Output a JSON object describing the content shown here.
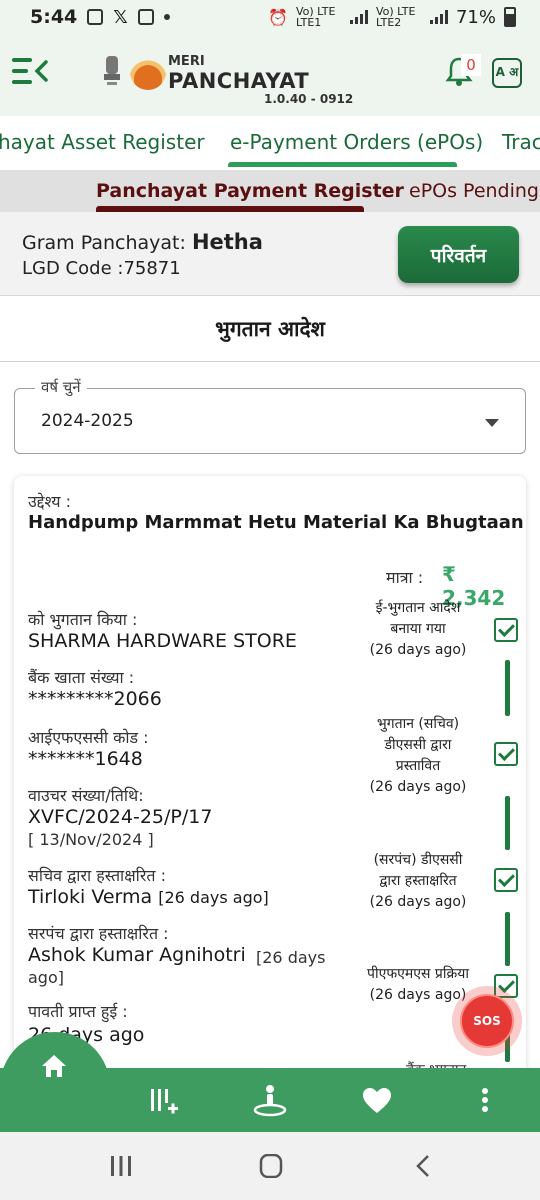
{
  "status_bar": {
    "time": "5:44",
    "network1": "Vo) LTE LTE1",
    "network2": "Vo) LTE LTE2",
    "battery": "71%"
  },
  "header": {
    "logo_small": "MERI",
    "logo_text": "PANCHAYAT",
    "version": "1.0.40 - 0912",
    "notification_count": "0",
    "lang_icon_text": "A अ"
  },
  "tabs": [
    {
      "label": "hayat Asset Register"
    },
    {
      "label": "e-Payment Orders (ePOs)"
    },
    {
      "label": "Trac"
    }
  ],
  "subtabs": [
    {
      "label": "Panchayat Payment Register"
    },
    {
      "label": "ePOs Pending"
    }
  ],
  "panchayat": {
    "gp_label": "Gram Panchayat: ",
    "gp_name": "Hetha",
    "lgd_label": "LGD Code :",
    "lgd_code": "75871",
    "change_button": "परिवर्तन"
  },
  "section_title": "भुगतान आदेश",
  "year_select": {
    "label": "वर्ष चुनें",
    "value": "2024-2025"
  },
  "order": {
    "purpose_label": "उद्देश्य :",
    "purpose": "Handpump Marmmat Hetu Material Ka Bhugtaan",
    "amount_label": "मात्रा :",
    "amount": "₹ 2,342",
    "paid_to_label": "को भुगतान किया :",
    "paid_to": "SHARMA HARDWARE STORE",
    "account_label": "बैंक खाता संख्या :",
    "account": "*********2066",
    "ifsc_label": "आईएफएससी कोड :",
    "ifsc": "*******1648",
    "voucher_label": "वाउचर संख्या/तिथि:",
    "voucher": "XVFC/2024-25/P/17",
    "voucher_date": "[ 13/Nov/2024 ]",
    "secretary_label": "सचिव द्वारा हस्ताक्षरित :",
    "secretary": "Tirloki Verma",
    "secretary_time": "[26 days ago]",
    "sarpanch_label": "सरपंच द्वारा हस्ताक्षरित :",
    "sarpanch": "Ashok Kumar Agnihotri",
    "sarpanch_time_1": "[26 days",
    "sarpanch_time_2": "ago]",
    "receipt_label": "पावती प्राप्त हुई :",
    "receipt": "26 days ago",
    "cut_label": "... ... ...",
    "cut_status": "बैंक भुगतान"
  },
  "timeline": [
    {
      "line1": "ई-भुगतान आदेश",
      "line2": "बनाया गया",
      "line3": "(26 days ago)"
    },
    {
      "line1": "भुगतान (सचिव)",
      "line2": "डीएससी द्वारा",
      "line3": "प्रस्तावित",
      "line4": "(26 days ago)"
    },
    {
      "line1": "(सरपंच) डीएससी",
      "line2": "द्वारा हस्ताक्षरित",
      "line3": "(26 days ago)"
    },
    {
      "line1": "पीएफएमएस प्रक्रिया",
      "line2": "(26 days ago)"
    }
  ],
  "sos_label": "SOS",
  "colors": {
    "primary_green": "#1e7a3e",
    "nav_green": "#3f9c61",
    "amount_green": "#3aa76a",
    "subtab_maroon": "#5a1010",
    "sos_red": "#e53935"
  }
}
